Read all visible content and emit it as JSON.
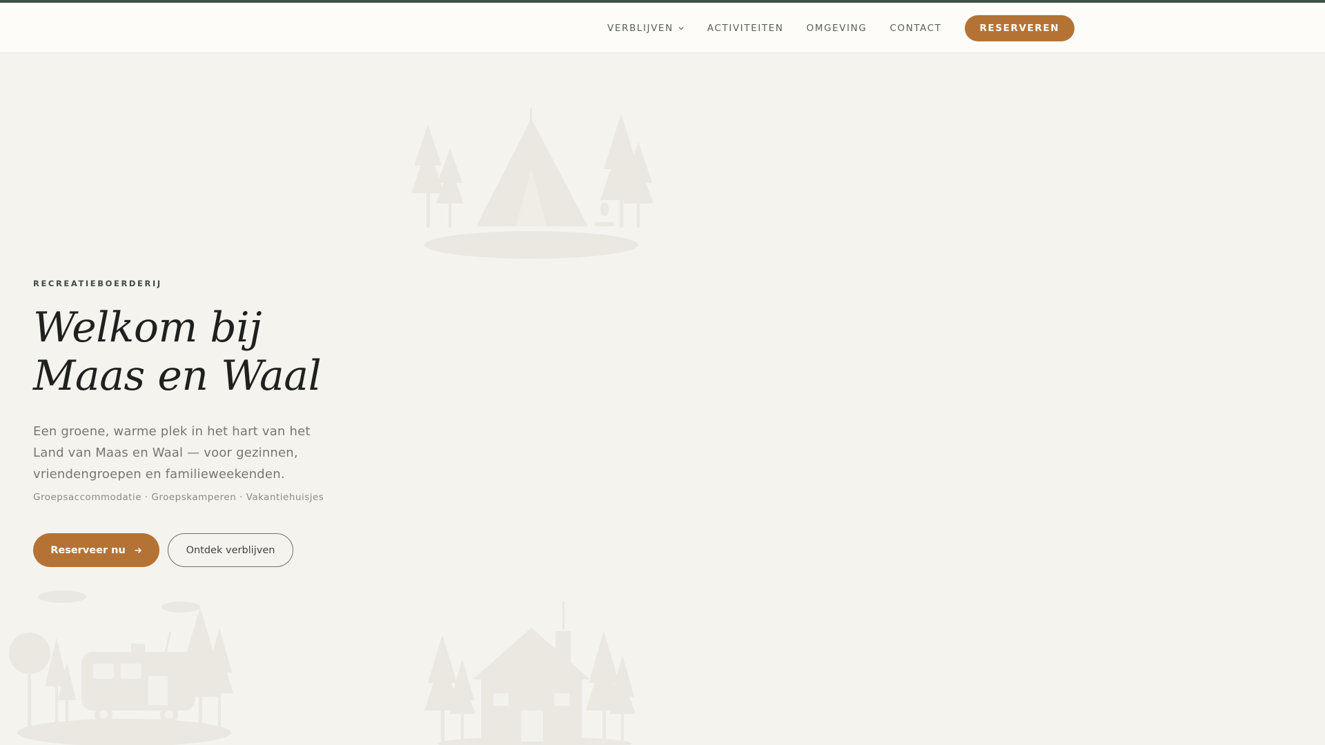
{
  "nav": {
    "items": [
      {
        "label": "VERBLIJVEN",
        "has_dropdown": true
      },
      {
        "label": "ACTIVITEITEN",
        "has_dropdown": false
      },
      {
        "label": "OMGEVING",
        "has_dropdown": false
      },
      {
        "label": "CONTACT",
        "has_dropdown": false
      }
    ],
    "cta_label": "RESERVEREN"
  },
  "hero": {
    "eyebrow": "RECREATIEBOERDERIJ",
    "title_line1": "Welkom bij",
    "title_line2": "Maas en Waal",
    "description": "Een groene, warme plek in het hart van het Land van Maas en Waal — voor gezinnen, vriendengroepen en familieweekenden.",
    "tags": "Groepsaccommodatie · Groepskamperen · Vakantiehuisjes",
    "primary_button": "Reserveer nu",
    "secondary_button": "Ontdek verblijven"
  },
  "icons": {
    "chevron": "chevron-down-icon",
    "arrow": "arrow-right-icon"
  },
  "colors": {
    "accent": "#b47335",
    "top_bar": "#3e5248",
    "background": "#f5f3ee",
    "header_bg": "#fdfcf8",
    "illustration": "#ebe8e2"
  }
}
